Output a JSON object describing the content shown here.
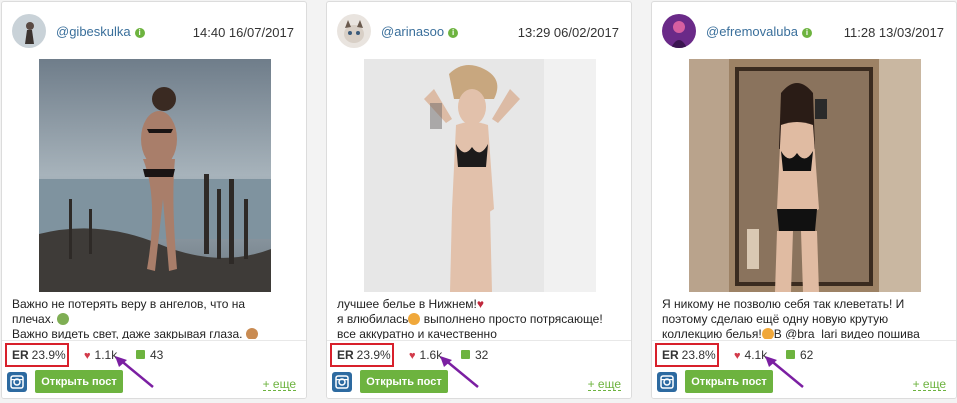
{
  "cards": [
    {
      "username": "@gibeskulka",
      "timestamp": "14:40 16/07/2017",
      "caption_lines": [
        "Важно не потерять веру в ангелов, что на",
        "плечах.",
        "Важно видеть свет, даже закрывая глаза."
      ],
      "er_label": "ER",
      "er_value": "23.9%",
      "likes": "1.1k",
      "comments": "43",
      "open_label": "Открыть пост",
      "more_label": "+ еще"
    },
    {
      "username": "@arinasoo",
      "timestamp": "13:29 06/02/2017",
      "caption_lines": [
        "лучшее белье в Нижнем!",
        "я влюбилась",
        " выполнено просто потрясающе!",
        "все аккуратно и качественно"
      ],
      "er_label": "ER",
      "er_value": "23.9%",
      "likes": "1.6k",
      "comments": "32",
      "open_label": "Открыть пост",
      "more_label": "+ еще"
    },
    {
      "username": "@efremovaluba",
      "timestamp": "11:28 13/03/2017",
      "caption_lines": [
        "Я никому не позволю себя так клеветать! И",
        "поэтому сделаю ещё одну новую крутую",
        "коллекцию белья!",
        "В @bra_lari видео пошива"
      ],
      "er_label": "ER",
      "er_value": "23.8%",
      "likes": "4.1k",
      "comments": "62",
      "open_label": "Открыть пост",
      "more_label": "+ еще"
    }
  ],
  "icons": {
    "verified": "verified-check-icon",
    "heart": "heart-icon",
    "comment": "comment-icon",
    "instagram": "instagram-icon",
    "annotation": "purple-arrow-icon"
  },
  "colors": {
    "accent_green": "#6db33f",
    "highlight_red": "#d8202b",
    "username_blue": "#3a6f9b",
    "heart_red": "#d23a4a",
    "instagram_blue": "#2d6aa0",
    "annotation_purple": "#7b1fa2"
  }
}
